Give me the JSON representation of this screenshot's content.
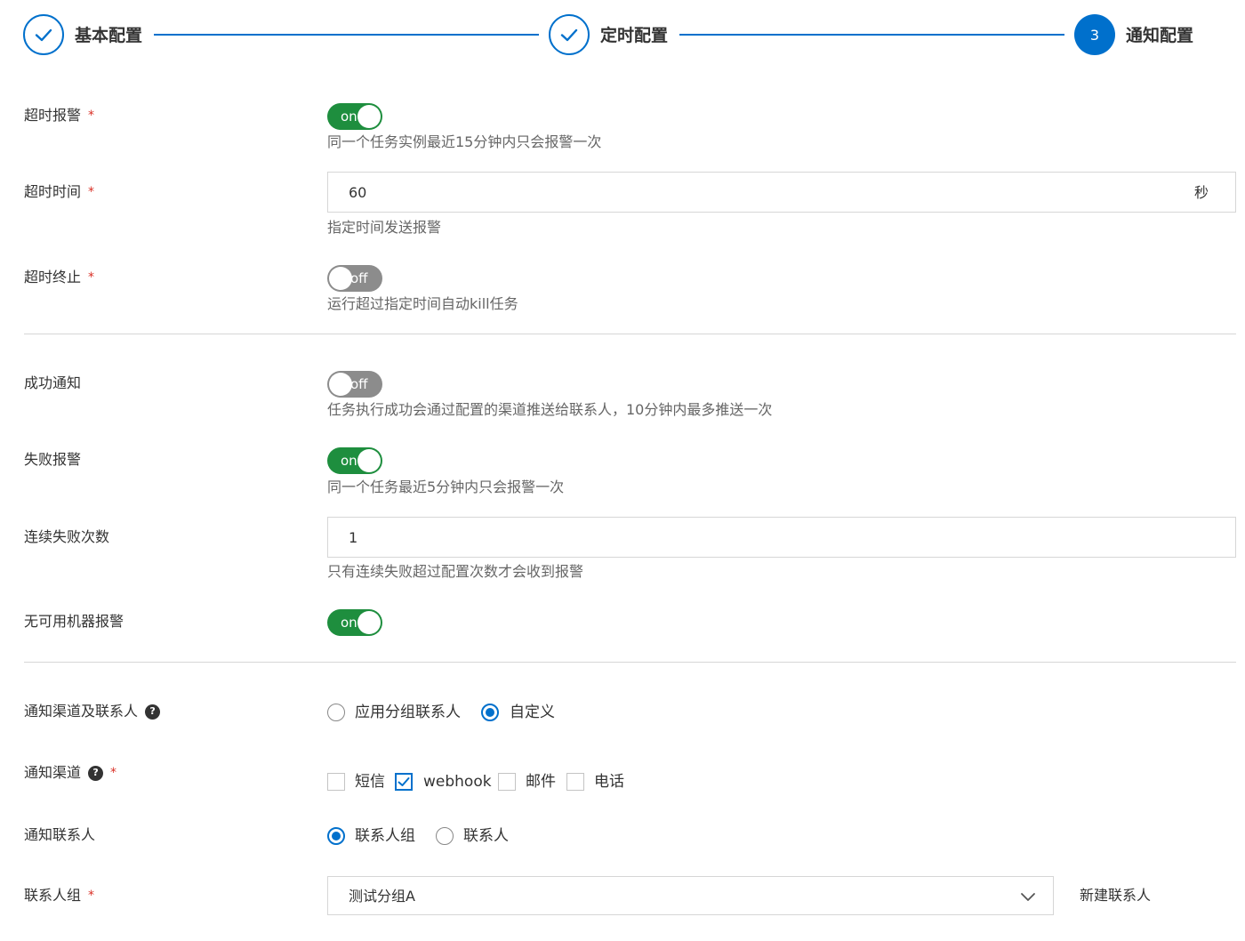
{
  "steps": [
    {
      "label": "基本配置",
      "status": "done"
    },
    {
      "label": "定时配置",
      "status": "done"
    },
    {
      "label": "通知配置",
      "status": "active",
      "number": "3"
    }
  ],
  "colors": {
    "primary": "#0070cc",
    "switch_on": "#1e8e3e",
    "switch_off": "#8c8c8c",
    "required": "#d93026"
  },
  "timeout_alert": {
    "label": "超时报警",
    "required_mark": "*",
    "switch_text": "on",
    "hint": "同一个任务实例最近15分钟内只会报警一次"
  },
  "timeout_time": {
    "label": "超时时间",
    "required_mark": "*",
    "value": "60",
    "suffix": "秒",
    "hint": "指定时间发送报警"
  },
  "timeout_kill": {
    "label": "超时终止",
    "required_mark": "*",
    "switch_text": "off",
    "hint": "运行超过指定时间自动kill任务"
  },
  "success_notify": {
    "label": "成功通知",
    "switch_text": "off",
    "hint": "任务执行成功会通过配置的渠道推送给联系人，10分钟内最多推送一次"
  },
  "fail_alert": {
    "label": "失败报警",
    "switch_text": "on",
    "hint": "同一个任务最近5分钟内只会报警一次"
  },
  "consecutive_fail": {
    "label": "连续失败次数",
    "value": "1",
    "hint": "只有连续失败超过配置次数才会收到报警"
  },
  "no_machine_alert": {
    "label": "无可用机器报警",
    "switch_text": "on"
  },
  "channel_contacts": {
    "label": "通知渠道及联系人",
    "help": "?",
    "options": [
      "应用分组联系人",
      "自定义"
    ],
    "selected": "自定义"
  },
  "channels": {
    "label": "通知渠道",
    "help": "?",
    "required_mark": "*",
    "options": [
      "短信",
      "webhook",
      "邮件",
      "电话"
    ],
    "checked": [
      "webhook"
    ]
  },
  "contacts": {
    "label": "通知联系人",
    "options": [
      "联系人组",
      "联系人"
    ],
    "selected": "联系人组"
  },
  "contact_group": {
    "label": "联系人组",
    "required_mark": "*",
    "value": "测试分组A",
    "new_contact": "新建联系人"
  }
}
